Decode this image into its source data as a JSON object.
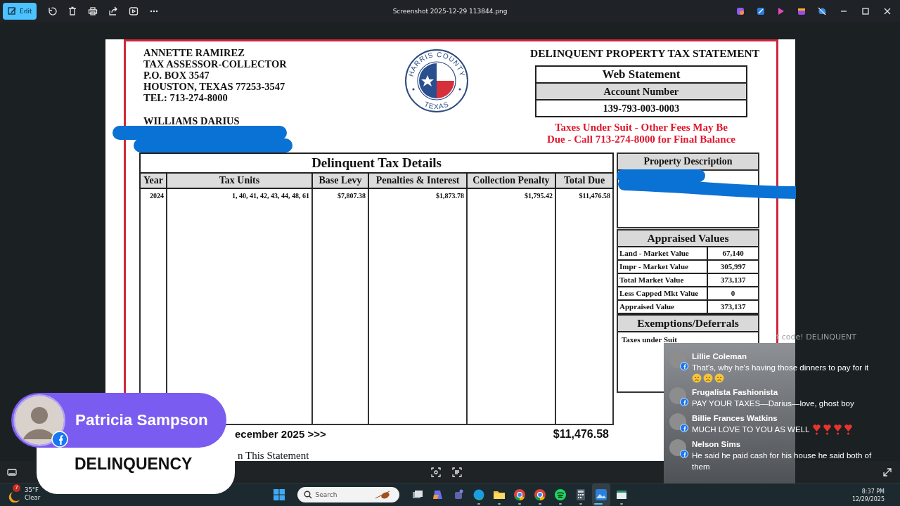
{
  "window": {
    "title": "Screenshot 2025-12-29 113844.png",
    "edit_button": {
      "label": "Edit",
      "selected": true
    }
  },
  "statement": {
    "sender": [
      "ANNETTE RAMIREZ",
      "TAX ASSESSOR-COLLECTOR",
      "P.O. BOX 3547",
      "HOUSTON, TEXAS 77253-3547",
      "TEL: 713-274-8000"
    ],
    "owner": "WILLIAMS DARIUS",
    "seal": {
      "top_text": "HARRIS COUNTY",
      "bottom_text": "TEXAS"
    },
    "title": "DELINQUENT PROPERTY TAX STATEMENT",
    "web_statement": "Web Statement",
    "account_label": "Account Number",
    "account_number": "139-793-003-0003",
    "notice_lines": [
      "Taxes Under Suit - Other Fees May Be",
      "Due - Call 713-274-8000 for Final Balance"
    ],
    "details": {
      "title": "Delinquent Tax Details",
      "columns": [
        "Year",
        "Tax Units",
        "Base Levy",
        "Penalties & Interest",
        "Collection Penalty",
        "Total Due"
      ],
      "rows": [
        [
          "2024",
          "1, 40, 41, 42, 43, 44, 48, 61",
          "$7,807.38",
          "$1,873.78",
          "$1,795.42",
          "$11,476.58"
        ]
      ]
    },
    "footer_due": "ecember 2025 >>>",
    "footer_total": "$11,476.58",
    "footer_note": "n This Statement",
    "property_description": {
      "title": "Property Description"
    },
    "appraised": {
      "title": "Appraised Values",
      "rows": [
        {
          "label": "Land - Market Value",
          "value": "67,140"
        },
        {
          "label": "Impr - Market Value",
          "value": "305,997"
        },
        {
          "label": "Total Market Value",
          "value": "373,137"
        },
        {
          "label": "Less Capped Mkt Value",
          "value": "0"
        },
        {
          "label": "Appraised Value",
          "value": "373,137"
        }
      ]
    },
    "exemptions": {
      "title": "Exemptions/Deferrals",
      "text": "Taxes under Suit"
    }
  },
  "streamer": {
    "name": "Patricia Sampson",
    "caption": "DELINQUENCY"
  },
  "chat": {
    "faded_text": "t code! DELINQUENT",
    "messages": [
      {
        "name": "Lillie Coleman",
        "text": "That's, why he's having those dinners to pay for it",
        "emojis": [
          {
            "kind": "sad-face"
          },
          {
            "kind": "sad-face"
          },
          {
            "kind": "sad-face"
          }
        ]
      },
      {
        "name": "Frugalista Fashionista",
        "text": "PAY YOUR TAXES—Darius—love, ghost boy"
      },
      {
        "name": "Billie Frances Watkins",
        "text": "MUCH LOVE TO YOU AS WELL",
        "emojis": [
          {
            "kind": "heart"
          },
          {
            "kind": "heart"
          },
          {
            "kind": "heart"
          },
          {
            "kind": "heart"
          }
        ]
      },
      {
        "name": "Nelson Sims",
        "text": "He said he paid cash for his house he said both of them"
      }
    ]
  },
  "taskbar": {
    "weather": {
      "temp": "35°F",
      "condition": "Clear",
      "badge": "7"
    },
    "search": {
      "placeholder": "Search"
    },
    "apps": [
      {
        "kind": "task-view",
        "selected": false,
        "running": false
      },
      {
        "kind": "copilot",
        "selected": false,
        "running": false
      },
      {
        "kind": "teams",
        "selected": false,
        "running": false
      },
      {
        "kind": "edge",
        "selected": false,
        "running": true
      },
      {
        "kind": "folder",
        "selected": false,
        "running": true
      },
      {
        "kind": "chrome",
        "selected": false,
        "running": true
      },
      {
        "kind": "chrome",
        "selected": false,
        "running": true
      },
      {
        "kind": "spotify",
        "selected": false,
        "running": true
      },
      {
        "kind": "calculator",
        "selected": false,
        "running": true
      },
      {
        "kind": "photos",
        "selected": true,
        "running": true
      },
      {
        "kind": "window",
        "selected": false,
        "running": true
      }
    ],
    "time": "8:37 PM",
    "date": "12/29/2025"
  }
}
